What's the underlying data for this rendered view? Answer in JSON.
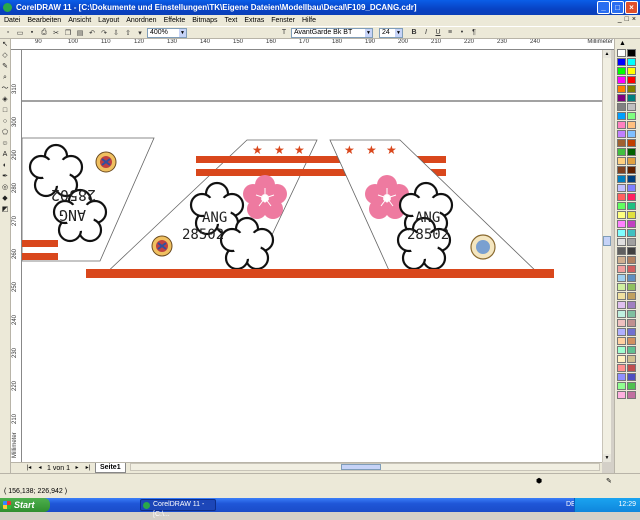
{
  "window": {
    "title": "CorelDRAW 11 - [C:\\Dokumente und Einstellungen\\TK\\Eigene Dateien\\Modellbau\\Decal\\F109_DCANG.cdr]",
    "minimize": "_",
    "maximize": "□",
    "close": "×"
  },
  "menu": [
    "Datei",
    "Bearbeiten",
    "Ansicht",
    "Layout",
    "Anordnen",
    "Effekte",
    "Bitmaps",
    "Text",
    "Extras",
    "Fenster",
    "Hilfe"
  ],
  "toolbar": {
    "zoom_value": "400%",
    "font_name": "AvantGarde Bk BT",
    "font_size": "24"
  },
  "ruler": {
    "unit": "Millimeter",
    "h_ticks": [
      "90",
      "100",
      "110",
      "120",
      "130",
      "140",
      "150",
      "160",
      "170",
      "180",
      "190",
      "200",
      "210",
      "220",
      "230",
      "240",
      "250",
      "260"
    ],
    "v_ticks": [
      "310",
      "300",
      "290",
      "280",
      "270",
      "260",
      "250",
      "240",
      "230",
      "220",
      "210"
    ]
  },
  "decal": {
    "text_ang": "ANG",
    "text_number": "28502",
    "flower_color": "#ee7aa0",
    "stripe_color": "#d9471c",
    "star_color": "#d9471c"
  },
  "pagebar": {
    "page_count": "1 von 1",
    "page_tab": "Seite1"
  },
  "status": {
    "coords": "( 156,138; 226,942 )"
  },
  "taskbar": {
    "start": "Start",
    "task_label": "CorelDRAW 11 - [C:\\...",
    "lang": "DE",
    "clock": "12:29"
  },
  "colors": {
    "title_blue": "#0842c4",
    "orange": "#d9471c",
    "pink": "#ee7aa0"
  }
}
